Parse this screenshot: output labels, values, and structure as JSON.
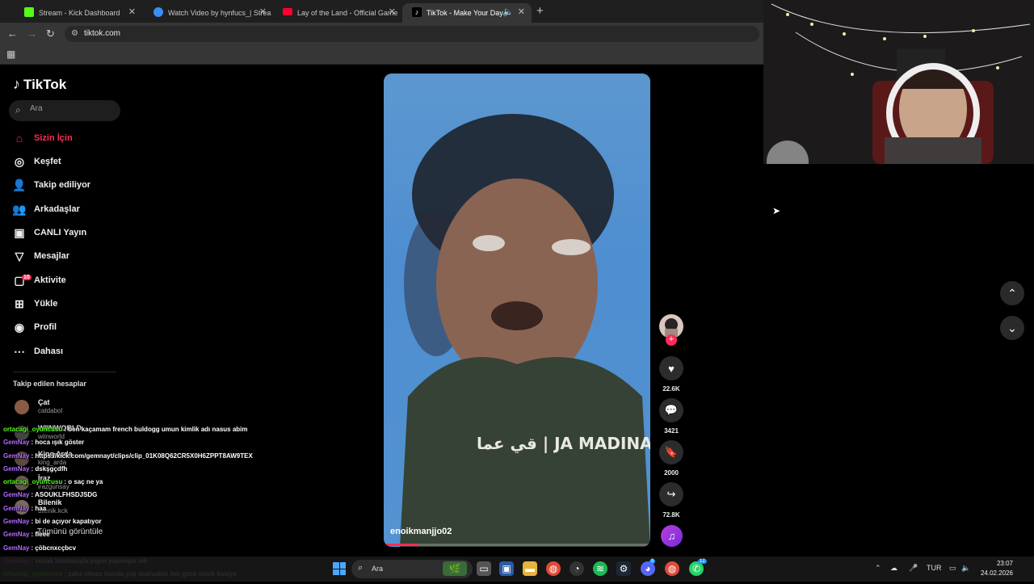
{
  "browser": {
    "tabs": [
      {
        "title": "Stream - Kick Dashboard",
        "favicon_color": "#53fc18"
      },
      {
        "title": "Watch Video by hynfucs_| Strea",
        "favicon_color": "#3a8ef6"
      },
      {
        "title": "Lay of the Land - Official Game",
        "favicon_color": "#ff0033"
      },
      {
        "title": "TikTok - Make Your Day",
        "favicon_color": "#000000"
      }
    ],
    "url": "tiktok.com"
  },
  "sidebar": {
    "logo": "TikTok",
    "search_placeholder": "Ara",
    "nav": [
      {
        "label": "Sizin İçin",
        "icon": "home-icon"
      },
      {
        "label": "Keşfet",
        "icon": "compass-icon"
      },
      {
        "label": "Takip ediliyor",
        "icon": "following-icon"
      },
      {
        "label": "Arkadaşlar",
        "icon": "friends-icon"
      },
      {
        "label": "CANLI Yayın",
        "icon": "live-icon"
      },
      {
        "label": "Mesajlar",
        "icon": "messages-icon"
      },
      {
        "label": "Aktivite",
        "icon": "activity-icon",
        "badge": "10"
      },
      {
        "label": "Yükle",
        "icon": "upload-icon"
      },
      {
        "label": "Profil",
        "icon": "profile-icon"
      },
      {
        "label": "Dahası",
        "icon": "more-icon"
      }
    ],
    "following_heading": "Takip edilen hesaplar",
    "accounts": [
      {
        "name": "Çat",
        "handle": "catdabol"
      },
      {
        "name": "WIINWORLD",
        "handle": "wiinworld"
      },
      {
        "name": "King Arda",
        "handle": "king_arda"
      },
      {
        "name": "İraz",
        "handle": "irazgunsay"
      },
      {
        "name": "Bilenik",
        "handle": "bilenik.kck"
      }
    ],
    "see_all": "Tümünü görüntüle"
  },
  "chat": [
    {
      "user": "ortacagi_oyuncusu",
      "color": "#53fc18",
      "msg": ": ben kaçamam french buldogg umun kimlik adı nasus abim"
    },
    {
      "user": "GemNay",
      "color": "#b26bff",
      "msg": ": hoca ışık göster"
    },
    {
      "user": "GemNay",
      "color": "#b26bff",
      "msg": ": https://kick.com/gemnayt/clips/clip_01K08Q62CR5X0H6ZPPT8AW9TEX"
    },
    {
      "user": "GemNay",
      "color": "#b26bff",
      "msg": ": dskşgçdfh"
    },
    {
      "user": "ortacagi_oyuncusu",
      "color": "#53fc18",
      "msg": ": o saç ne ya"
    },
    {
      "user": "GemNay",
      "color": "#b26bff",
      "msg": ": ASOUKLFHSDJSDG"
    },
    {
      "user": "GemNay",
      "color": "#b26bff",
      "msg": ": haa"
    },
    {
      "user": "GemNay",
      "color": "#b26bff",
      "msg": ": bi de açıyor kapatıyor"
    },
    {
      "user": "GemNay",
      "color": "#b26bff",
      "msg": ": fleee"
    },
    {
      "user": "GemNay",
      "color": "#b26bff",
      "msg": ": çöbcnxcçbcv"
    },
    {
      "user": "GemNay",
      "color": "#b26bff",
      "msg": ": sokak lambasıyla yayın yapmışın mk"
    },
    {
      "user": "ortacagi_oyuncusu",
      "color": "#53fc18",
      "msg": ": şaka olmaz bunda yaş mamadan her gece stack kasıyo"
    }
  ],
  "video": {
    "author": "enoikmanjjo02",
    "shirt_text": "قي عما | JA MADINAH",
    "progress": 0.13
  },
  "actions": {
    "likes": "22.6K",
    "comments": "3421",
    "saves": "2000",
    "shares": "72.8K"
  },
  "taskbar": {
    "search_label": "Ara",
    "lang": "TUR",
    "time": "23:07",
    "date": "24.02.2026",
    "badges": {
      "discord": "9",
      "whatsapp": "12"
    }
  },
  "colors": {
    "accent": "#fe2c55",
    "kick": "#53fc18"
  }
}
